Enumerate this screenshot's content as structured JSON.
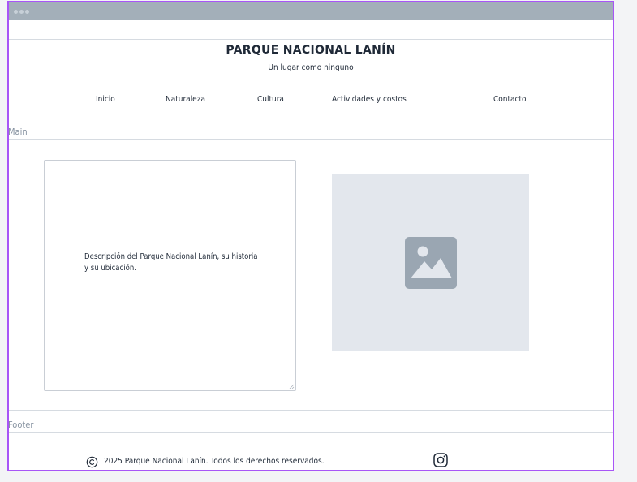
{
  "header": {
    "title": "PARQUE NACIONAL LANÍN",
    "subtitle": "Un lugar como ninguno"
  },
  "nav": {
    "items": [
      {
        "label": "Inicio"
      },
      {
        "label": "Naturaleza"
      },
      {
        "label": "Cultura"
      },
      {
        "label": "Actividades y costos"
      },
      {
        "label": "Contacto"
      }
    ]
  },
  "main": {
    "section_label": "Main",
    "description": "Descripción del Parque Nacional Lanín, su historia y su ubicación.",
    "image_icon": "image-placeholder-icon"
  },
  "footer": {
    "section_label": "Footer",
    "copyright_icon": "copyright-icon",
    "copyright": "2025 Parque Nacional Lanín. Todos los derechos reservados.",
    "social_icon": "instagram-icon"
  },
  "colors": {
    "frame_outline": "#a855f7",
    "titlebar": "#a3afb9",
    "placeholder_bg": "#e3e7ed",
    "placeholder_icon": "#9aa6b2"
  }
}
